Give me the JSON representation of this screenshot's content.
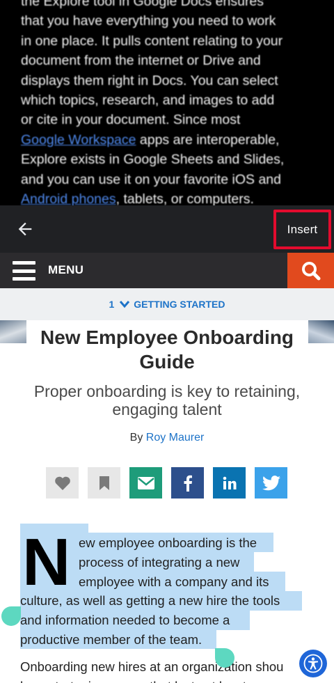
{
  "preview": {
    "lines": [
      "the Explore tool in Google Docs ensures",
      "that you have everything you need to work",
      "in one place. It pulls content relating to your",
      "document from the internet or Drive and",
      "displays them right in Docs. You can select",
      "which topics, research, and images to add",
      "or cite in your document. Since most"
    ],
    "line8_link": "Google Workspace",
    "line8_rest": " apps are interoperable,",
    "line9": "Explore exists in Google Sheets and Slides,",
    "line10": "and you can use it on your favorite iOS and",
    "line11_link": "Android phones",
    "line11_rest": ", tablets, or computers."
  },
  "toolbar": {
    "insert_label": "Insert"
  },
  "site": {
    "menu_label": "MENU",
    "breadcrumb_number": "1",
    "breadcrumb_label": "GETTING STARTED"
  },
  "article": {
    "title_line1": "New Employee Onboarding",
    "title_line2": "Guide",
    "subtitle_line1": "Proper onboarding is key to retaining,",
    "subtitle_line2": "engaging talent",
    "byline_prefix": "By ",
    "author": "Roy Maurer",
    "dropcap": "N",
    "para1_lines": [
      "ew employee onboarding is the",
      "process of integrating a new",
      "employee with a company and its",
      "culture, as well as getting a new hire the tools",
      "and information needed to become a",
      "productive member of the team."
    ],
    "para2_line1": "Onboarding new hires at an organization shou",
    "para2_line2": "be a strategic process that lasts at least one"
  },
  "colors": {
    "insert_highlight": "#e30b2e",
    "search_bg": "#e14a1e",
    "link": "#1d73c8",
    "selection": "#bcdcf5",
    "handle": "#5dd8c0"
  }
}
